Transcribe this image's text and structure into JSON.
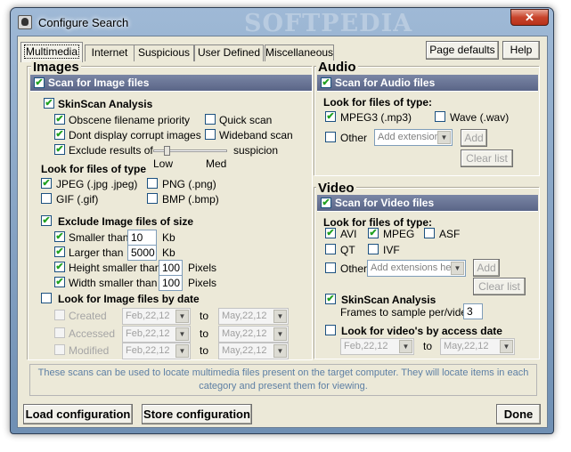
{
  "window": {
    "title": "Configure Search",
    "watermark": "SOFTPEDIA",
    "close_label": "✕"
  },
  "tabs": [
    {
      "label": "Multimedia",
      "active": true
    },
    {
      "label": "Internet"
    },
    {
      "label": "Suspicious"
    },
    {
      "label": "User Defined"
    },
    {
      "label": "Miscellaneous"
    }
  ],
  "top_buttons": {
    "page_defaults": "Page defaults",
    "help": "Help"
  },
  "images": {
    "group_title": "Images",
    "scan_label": "Scan for Image files",
    "skinscan": {
      "label": "SkinScan Analysis",
      "obscene": "Obscene filename priority",
      "quick": "Quick scan",
      "dont_display": "Dont display corrupt images",
      "wideband": "Wideband scan",
      "exclude_results": "Exclude results of",
      "suspicion": "suspicion",
      "slider_low": "Low",
      "slider_med": "Med",
      "slider_level": 0.16
    },
    "file_types_label": "Look for files of type",
    "types": {
      "jpeg": "JPEG  (.jpg .jpeg)",
      "png": "PNG (.png)",
      "gif": "GIF  (.gif)",
      "bmp": "BMP (.bmp)"
    },
    "exclude_size": {
      "label": "Exclude Image files of size",
      "smaller_than": "Smaller than",
      "smaller_value": "10",
      "smaller_unit": "Kb",
      "larger_than": "Larger than",
      "larger_value": "5000",
      "larger_unit": "Kb",
      "height_smaller": "Height smaller than",
      "height_value": "100",
      "height_unit": "Pixels",
      "width_smaller": "Width smaller than",
      "width_value": "100",
      "width_unit": "Pixels"
    },
    "by_date": {
      "label": "Look for Image files by date",
      "created": "Created",
      "accessed": "Accessed",
      "modified": "Modified",
      "from_date": "Feb,22,12",
      "to": "to",
      "to_date": "May,22,12"
    }
  },
  "audio": {
    "group_title": "Audio",
    "scan_label": "Scan for Audio files",
    "file_types_label": "Look for files of type:",
    "mp3": "MPEG3 (.mp3)",
    "wave": "Wave (.wav)",
    "other": "Other",
    "add_ext_placeholder": "Add extension",
    "add": "Add",
    "clear": "Clear list"
  },
  "video": {
    "group_title": "Video",
    "scan_label": "Scan for Video files",
    "file_types_label": "Look for files of type:",
    "avi": "AVI",
    "mpeg": "MPEG",
    "asf": "ASF",
    "qt": "QT",
    "ivf": "IVF",
    "other": "Other",
    "add_ext_placeholder": "Add extensions her",
    "add": "Add",
    "clear": "Clear list",
    "skinscan": "SkinScan Analysis",
    "frames_label": "Frames to sample per/video",
    "frames_value": "3",
    "by_access_date": "Look for video's by access date",
    "from_date": "Feb,22,12",
    "to": "to",
    "to_date": "May,22,12"
  },
  "info_text": "These scans can be used to locate multimedia files present on the target computer. They will locate items in each category and present them for viewing.",
  "bottom_buttons": {
    "load": "Load configuration",
    "store": "Store configuration",
    "done": "Done"
  },
  "glyphs": {
    "check": "✔",
    "dropdown": "▼"
  }
}
